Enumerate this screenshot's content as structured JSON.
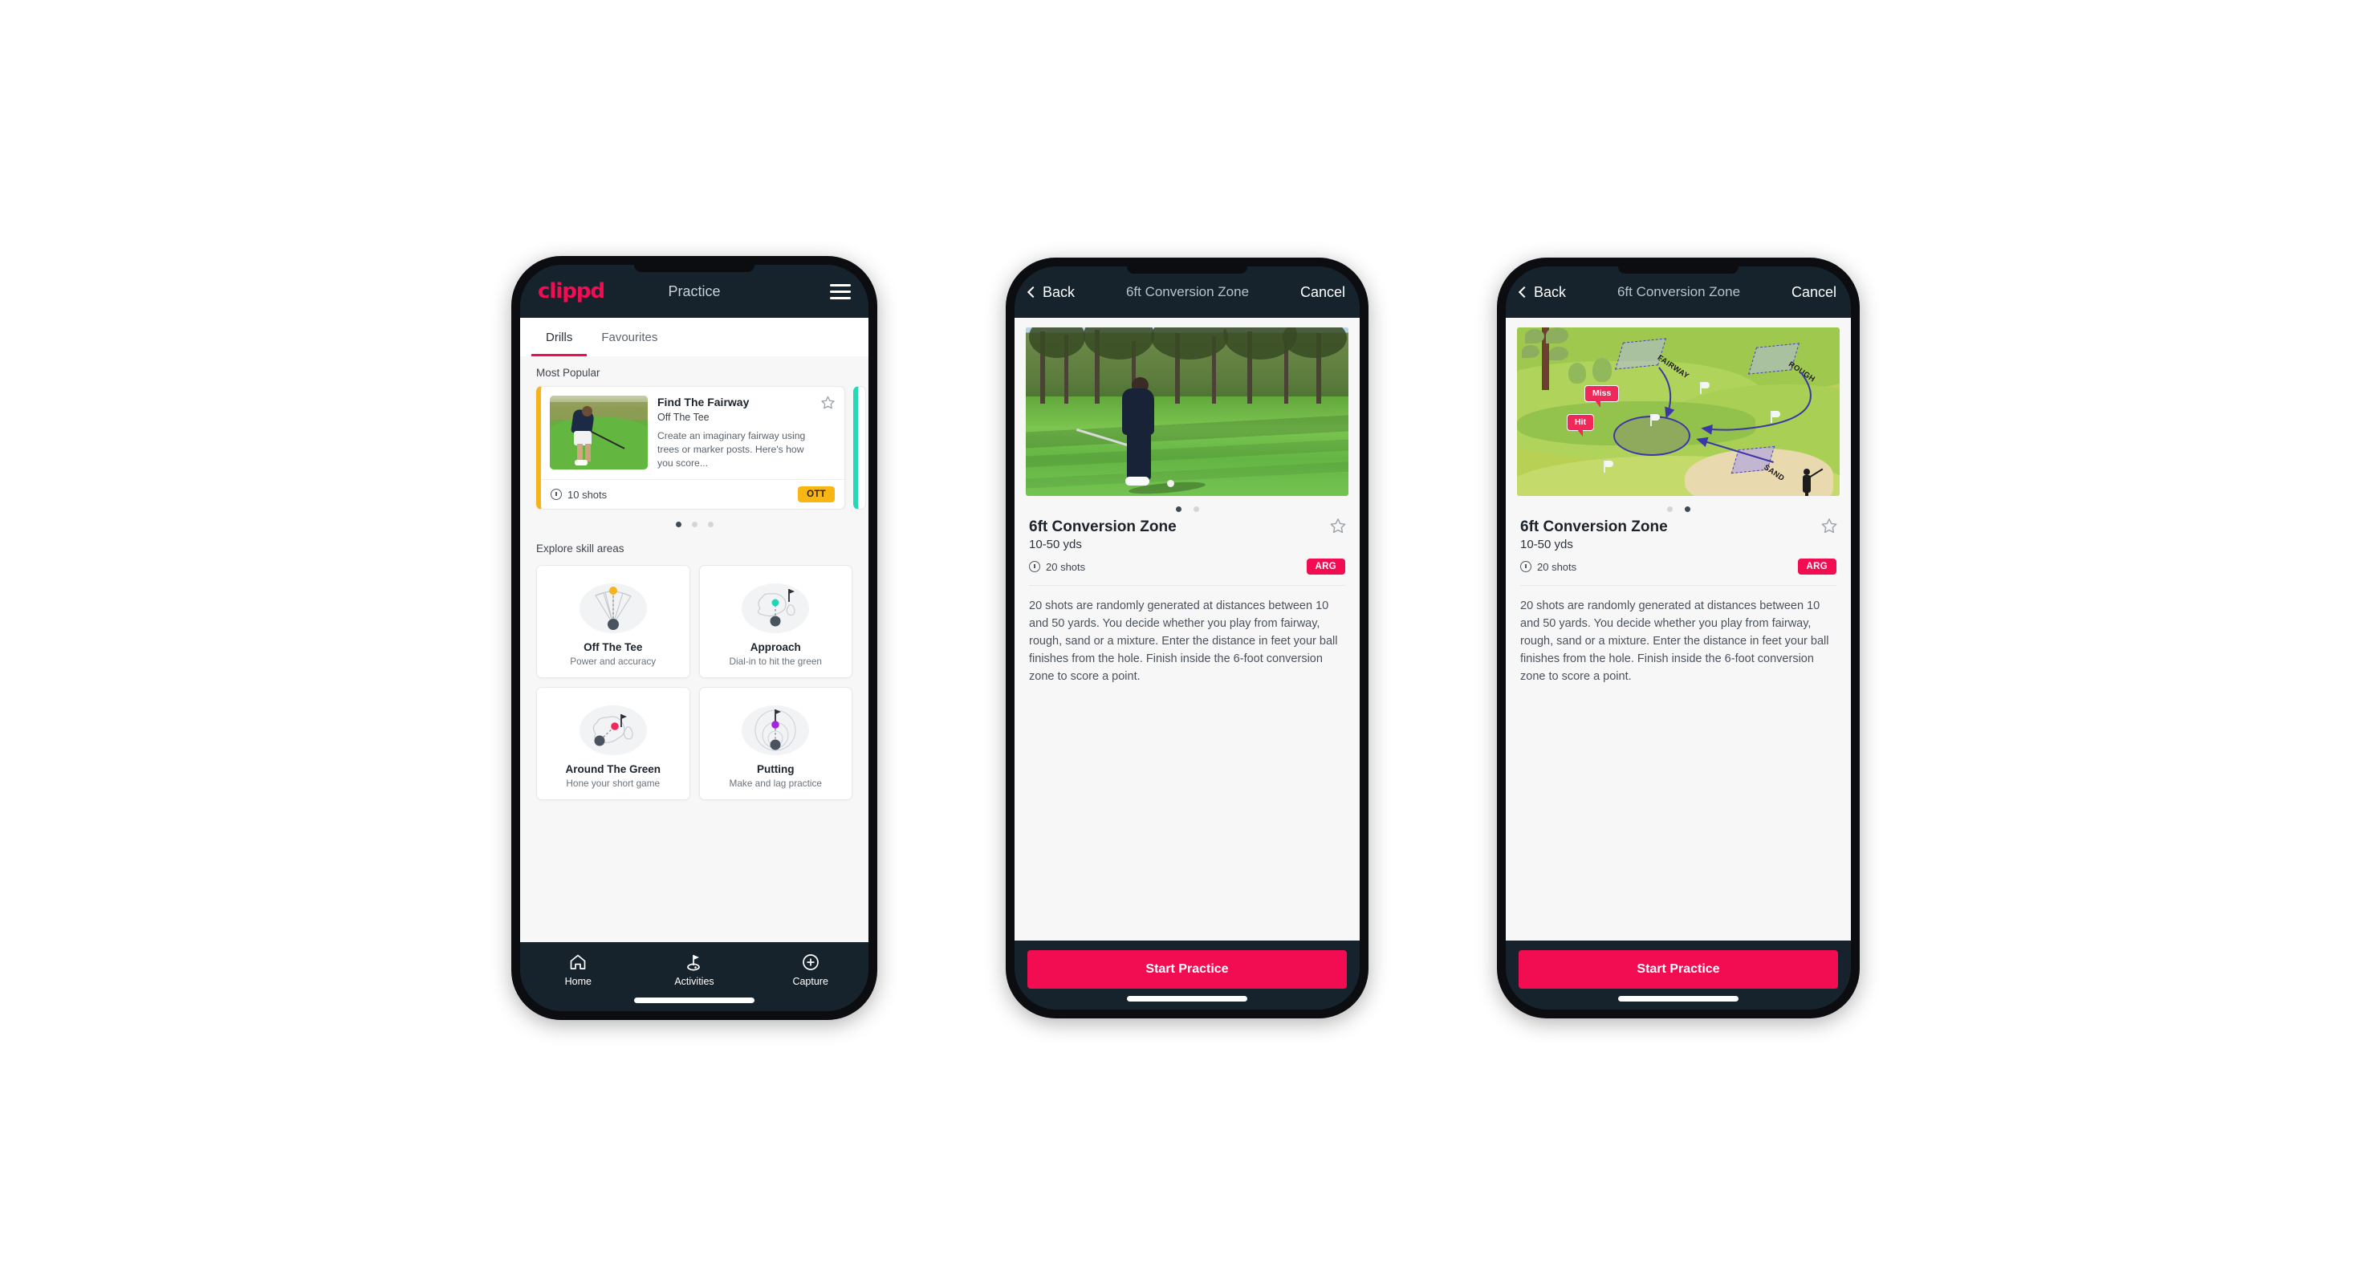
{
  "app": {
    "brand": "clippd",
    "accent_pink": "#f20c52",
    "header_navy": "#16222c",
    "badge_ott_color": "#f7b614",
    "badge_arg_color": "#f20c52"
  },
  "phone1": {
    "header": {
      "logo": "clippd",
      "title": "Practice",
      "menu_icon": "hamburger-icon"
    },
    "tabs": [
      {
        "label": "Drills",
        "active": true
      },
      {
        "label": "Favourites",
        "active": false
      }
    ],
    "most_popular": {
      "section_label": "Most Popular",
      "card": {
        "title": "Find The Fairway",
        "subtitle": "Off The Tee",
        "description": "Create an imaginary fairway using trees or marker posts. Here's how you score...",
        "shots": "10 shots",
        "badge": "OTT",
        "favourite_icon": "star-outline-icon",
        "shots_icon": "clock-icon",
        "accent_bar_color": "#f5b31c",
        "next_card_accent_color": "#27d8b6"
      },
      "dots": {
        "count": 3,
        "active_index": 0
      }
    },
    "skills": {
      "section_label": "Explore skill areas",
      "cards": [
        {
          "name": "Off The Tee",
          "desc": "Power and accuracy",
          "icon": "tee-fan-icon",
          "dot_color": "#f5b31c"
        },
        {
          "name": "Approach",
          "desc": "Dial-in to hit the green",
          "icon": "approach-green-icon",
          "dot_color": "#21d6b4"
        },
        {
          "name": "Around The Green",
          "desc": "Hone your short game",
          "icon": "around-green-icon",
          "dot_color": "#f0295a"
        },
        {
          "name": "Putting",
          "desc": "Make and lag practice",
          "icon": "putting-rings-icon",
          "dot_color": "#a327d8"
        }
      ]
    },
    "bottom_nav": [
      {
        "label": "Home",
        "icon": "home-icon",
        "active": false
      },
      {
        "label": "Activities",
        "icon": "golf-flag-icon",
        "active": true
      },
      {
        "label": "Capture",
        "icon": "plus-circle-icon",
        "active": false
      }
    ]
  },
  "phone2": {
    "navbar": {
      "back_label": "Back",
      "back_icon": "chevron-left-icon",
      "title": "6ft Conversion Zone",
      "cancel_label": "Cancel"
    },
    "hero": {
      "type": "photo",
      "alt": "golfer-chipping-photo"
    },
    "dots": {
      "count": 2,
      "active_index": 0
    },
    "detail": {
      "title": "6ft Conversion Zone",
      "range": "10-50 yds",
      "shots": "20 shots",
      "shots_icon": "clock-icon",
      "badge": "ARG",
      "favourite_icon": "star-outline-icon",
      "description": "20 shots are randomly generated at distances between 10 and 50 yards. You decide whether you play from fairway, rough, sand or a mixture. Enter the distance in feet your ball finishes from the hole. Finish inside the 6-foot conversion zone to score a point."
    },
    "cta": "Start Practice"
  },
  "phone3": {
    "navbar": {
      "back_label": "Back",
      "back_icon": "chevron-left-icon",
      "title": "6ft Conversion Zone",
      "cancel_label": "Cancel"
    },
    "hero": {
      "type": "illustration",
      "alt": "golf-course-diagram",
      "zone_labels": [
        "FAIRWAY",
        "ROUGH",
        "SAND"
      ],
      "result_tags": [
        "Miss",
        "Hit"
      ]
    },
    "dots": {
      "count": 2,
      "active_index": 1
    },
    "detail": {
      "title": "6ft Conversion Zone",
      "range": "10-50 yds",
      "shots": "20 shots",
      "shots_icon": "clock-icon",
      "badge": "ARG",
      "favourite_icon": "star-outline-icon",
      "description": "20 shots are randomly generated at distances between 10 and 50 yards. You decide whether you play from fairway, rough, sand or a mixture. Enter the distance in feet your ball finishes from the hole. Finish inside the 6-foot conversion zone to score a point."
    },
    "cta": "Start Practice"
  }
}
